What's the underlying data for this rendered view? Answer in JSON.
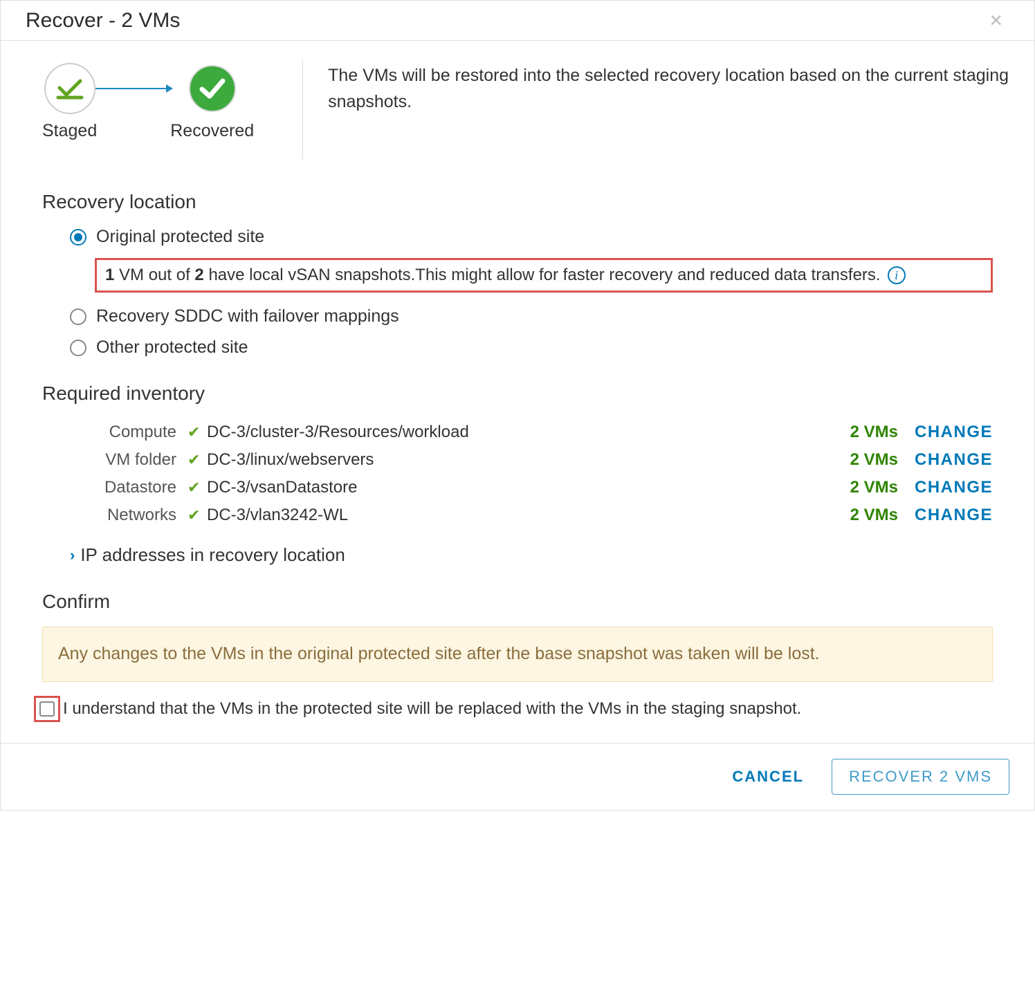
{
  "modal": {
    "title": "Recover - 2 VMs",
    "description": "The VMs will be restored into the selected recovery location based on the current staging snapshots."
  },
  "steps": {
    "staged": "Staged",
    "recovered": "Recovered"
  },
  "recovery": {
    "heading": "Recovery location",
    "opt_original": "Original protected site",
    "opt_sddc": "Recovery SDDC with failover mappings",
    "opt_other": "Other protected site",
    "snapshot_note_pre_bold": "1",
    "snapshot_note_mid_1": " VM out of ",
    "snapshot_note_bold2": "2",
    "snapshot_note_rest": " have local vSAN snapshots.This might allow for faster recovery and reduced data transfers."
  },
  "inventory": {
    "heading": "Required inventory",
    "rows": [
      {
        "label": "Compute",
        "path": "DC-3/cluster-3/Resources/workload",
        "count": "2 VMs"
      },
      {
        "label": "VM folder",
        "path": "DC-3/linux/webservers",
        "count": "2 VMs"
      },
      {
        "label": "Datastore",
        "path": "DC-3/vsanDatastore",
        "count": "2 VMs"
      },
      {
        "label": "Networks",
        "path": "DC-3/vlan3242-WL",
        "count": "2 VMs"
      }
    ],
    "change_label": "CHANGE",
    "ip_expand": "IP addresses in recovery location"
  },
  "confirm": {
    "heading": "Confirm",
    "warning": "Any changes to the VMs in the original protected site after the base snapshot was taken will be lost.",
    "ack": "I understand that the VMs in the protected site will be replaced with the VMs in the staging snapshot."
  },
  "footer": {
    "cancel": "CANCEL",
    "recover": "RECOVER 2 VMS"
  }
}
